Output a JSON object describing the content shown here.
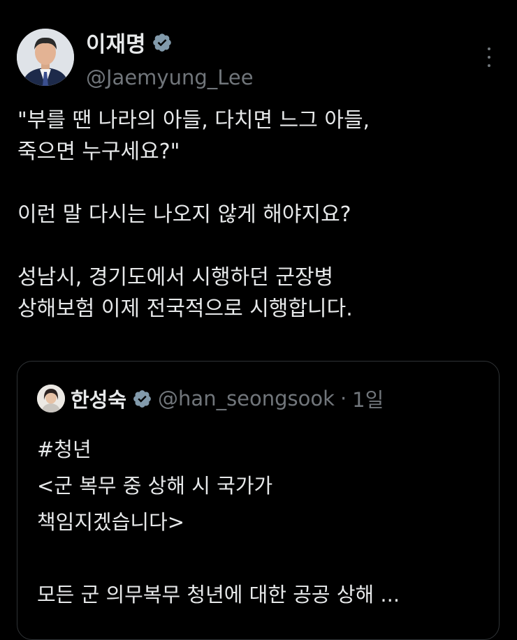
{
  "author": {
    "name": "이재명",
    "handle": "@Jaemyung_Lee",
    "avatar_icon": "profile-photo-icon",
    "verified_icon": "verified-badge-icon"
  },
  "tweet": {
    "paragraphs": [
      [
        "\"부를 땐 나라의 아들, 다치면 느그 아들,",
        "죽으면 누구세요?\""
      ],
      [
        "이런 말 다시는 나오지 않게 해야지요?"
      ],
      [
        "성남시, 경기도에서 시행하던 군장병",
        "상해보험 이제 전국적으로 시행합니다."
      ]
    ]
  },
  "quoted_tweet": {
    "name": "한성숙",
    "handle": "@han_seongsook",
    "separator": "·",
    "time": "1일",
    "lines": [
      "#청년",
      "<군 복무 중 상해 시 국가가",
      "책임지겠습니다>",
      "모든 군 의무복무 청년에 대한 공공 상해 ..."
    ]
  },
  "colors": {
    "background": "#000000",
    "text": "#e7e9ea",
    "secondary": "#71767b",
    "border": "#2f3336",
    "verified": "#829aab"
  }
}
